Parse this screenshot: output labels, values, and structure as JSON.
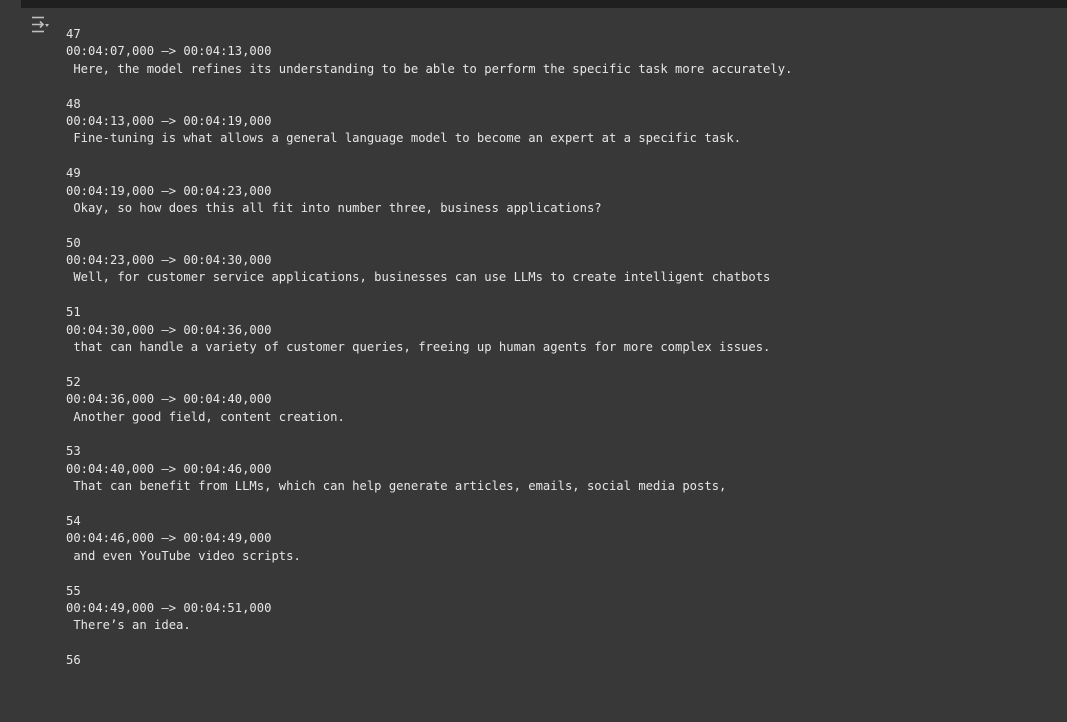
{
  "output_toggle_icon": "output-collapse-icon",
  "entries": [
    {
      "index": "47",
      "time": "00:04:07,000 —> 00:04:13,000",
      "text": " Here, the model refines its understanding to be able to perform the specific task more accurately."
    },
    {
      "index": "48",
      "time": "00:04:13,000 —> 00:04:19,000",
      "text": " Fine-tuning is what allows a general language model to become an expert at a specific task."
    },
    {
      "index": "49",
      "time": "00:04:19,000 —> 00:04:23,000",
      "text": " Okay, so how does this all fit into number three, business applications?"
    },
    {
      "index": "50",
      "time": "00:04:23,000 —> 00:04:30,000",
      "text": " Well, for customer service applications, businesses can use LLMs to create intelligent chatbots"
    },
    {
      "index": "51",
      "time": "00:04:30,000 —> 00:04:36,000",
      "text": " that can handle a variety of customer queries, freeing up human agents for more complex issues."
    },
    {
      "index": "52",
      "time": "00:04:36,000 —> 00:04:40,000",
      "text": " Another good field, content creation."
    },
    {
      "index": "53",
      "time": "00:04:40,000 —> 00:04:46,000",
      "text": " That can benefit from LLMs, which can help generate articles, emails, social media posts,"
    },
    {
      "index": "54",
      "time": "00:04:46,000 —> 00:04:49,000",
      "text": " and even YouTube video scripts."
    },
    {
      "index": "55",
      "time": "00:04:49,000 —> 00:04:51,000",
      "text": " There’s an idea."
    },
    {
      "index": "56",
      "time": "",
      "text": ""
    }
  ]
}
